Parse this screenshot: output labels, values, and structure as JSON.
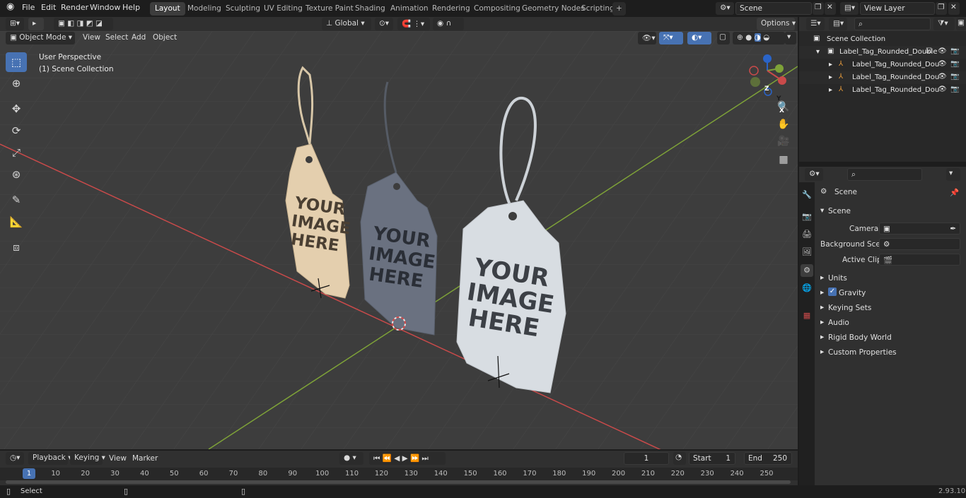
{
  "top_menu": [
    "File",
    "Edit",
    "Render",
    "Window",
    "Help"
  ],
  "workspace_tabs": [
    "Layout",
    "Modeling",
    "Sculpting",
    "UV Editing",
    "Texture Paint",
    "Shading",
    "Animation",
    "Rendering",
    "Compositing",
    "Geometry Nodes",
    "Scripting"
  ],
  "active_workspace": "Layout",
  "add_tab_label": "+",
  "scene_field": "Scene",
  "view_layer_field": "View Layer",
  "viewport_header": {
    "mode": "Object Mode",
    "menus": [
      "View",
      "Select",
      "Add",
      "Object"
    ],
    "transform_orientation": "Global",
    "options_label": "Options"
  },
  "viewport_overlay": {
    "perspective": "User Perspective",
    "collection": "(1) Scene Collection"
  },
  "tag_text": [
    "YOUR",
    "IMAGE",
    "HERE"
  ],
  "gizmo_axes": {
    "x": "X",
    "y": "Y",
    "z": "Z"
  },
  "outliner": {
    "root": "Scene Collection",
    "collection": "Label_Tag_Rounded_Double",
    "children": [
      "Label_Tag_Rounded_Dou",
      "Label_Tag_Rounded_Dou",
      "Label_Tag_Rounded_Dou"
    ]
  },
  "properties": {
    "breadcrumb": "Scene",
    "panel_title": "Scene",
    "camera_label": "Camera",
    "background_scene_label": "Background Scene",
    "active_clip_label": "Active Clip",
    "collapsed_panels": [
      "Units",
      "Gravity",
      "Keying Sets",
      "Audio",
      "Rigid Body World",
      "Custom Properties"
    ],
    "gravity_checked": true
  },
  "timeline": {
    "menus": [
      "Playback",
      "Keying",
      "View",
      "Marker"
    ],
    "current_frame": "1",
    "start_label": "Start",
    "start_value": "1",
    "end_label": "End",
    "end_value": "250",
    "ruler_ticks": [
      "1",
      "10",
      "20",
      "30",
      "40",
      "50",
      "60",
      "70",
      "80",
      "90",
      "100",
      "110",
      "120",
      "130",
      "140",
      "150",
      "160",
      "170",
      "180",
      "190",
      "200",
      "210",
      "220",
      "230",
      "240",
      "250"
    ]
  },
  "statusbar": {
    "left": "Select",
    "version": "2.93.10"
  },
  "colors": {
    "accent": "#4772b3",
    "x_axis": "#c94a4a",
    "y_axis": "#7ea238",
    "tag_tan": "#e4cfae",
    "tag_grey": "#6a7180",
    "tag_white": "#d8dde2"
  }
}
